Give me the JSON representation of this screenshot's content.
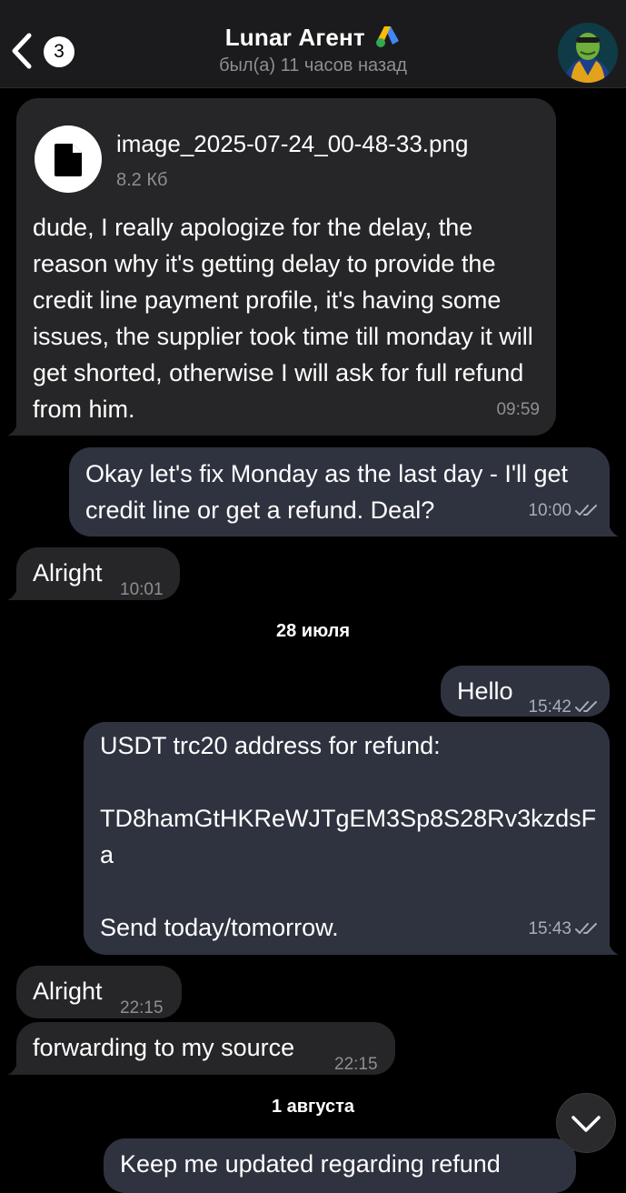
{
  "header": {
    "back_count": "3",
    "contact_name": "Lunar Агент",
    "status": "был(а) 11 часов назад"
  },
  "messages": {
    "m1": {
      "file_name": "image_2025-07-24_00-48-33.png",
      "file_size": "8.2 Кб",
      "text": "dude, I really apologize for the delay, the reason why it's getting delay to provide the credit line payment profile, it's having some issues, the supplier took time till monday it will get shorted, otherwise I will ask for full refund from him.",
      "time": "09:59"
    },
    "m2": {
      "text": "Okay let's fix Monday as the last day - I'll get credit line or get a refund. Deal?",
      "time": "10:00"
    },
    "m3": {
      "text": "Alright",
      "time": "10:01"
    },
    "m4": {
      "text": "Hello",
      "time": "15:42"
    },
    "m5": {
      "text": "USDT trc20 address for refund:\n\nTD8hamGtHKReWJTgEM3Sp8S28Rv3kzdsFa\n\nSend today/tomorrow.",
      "time": "15:43"
    },
    "m6": {
      "text": "Alright",
      "time": "22:15"
    },
    "m7": {
      "text": "forwarding to my source",
      "time": "22:15"
    },
    "m8": {
      "text": "Keep me updated regarding refund"
    }
  },
  "dates": {
    "d1": "28 июля",
    "d2": "1 августа"
  },
  "icons": {
    "back": "chevron-left-icon",
    "brand": "google-ads-logo",
    "file": "file-icon",
    "read": "double-check-icon",
    "scroll": "chevron-down-icon"
  },
  "colors": {
    "background": "#000000",
    "header": "#1b1b1d",
    "incoming_bubble": "#262628",
    "outgoing_bubble": "#2f3340",
    "meta_text": "#8e8e93"
  }
}
